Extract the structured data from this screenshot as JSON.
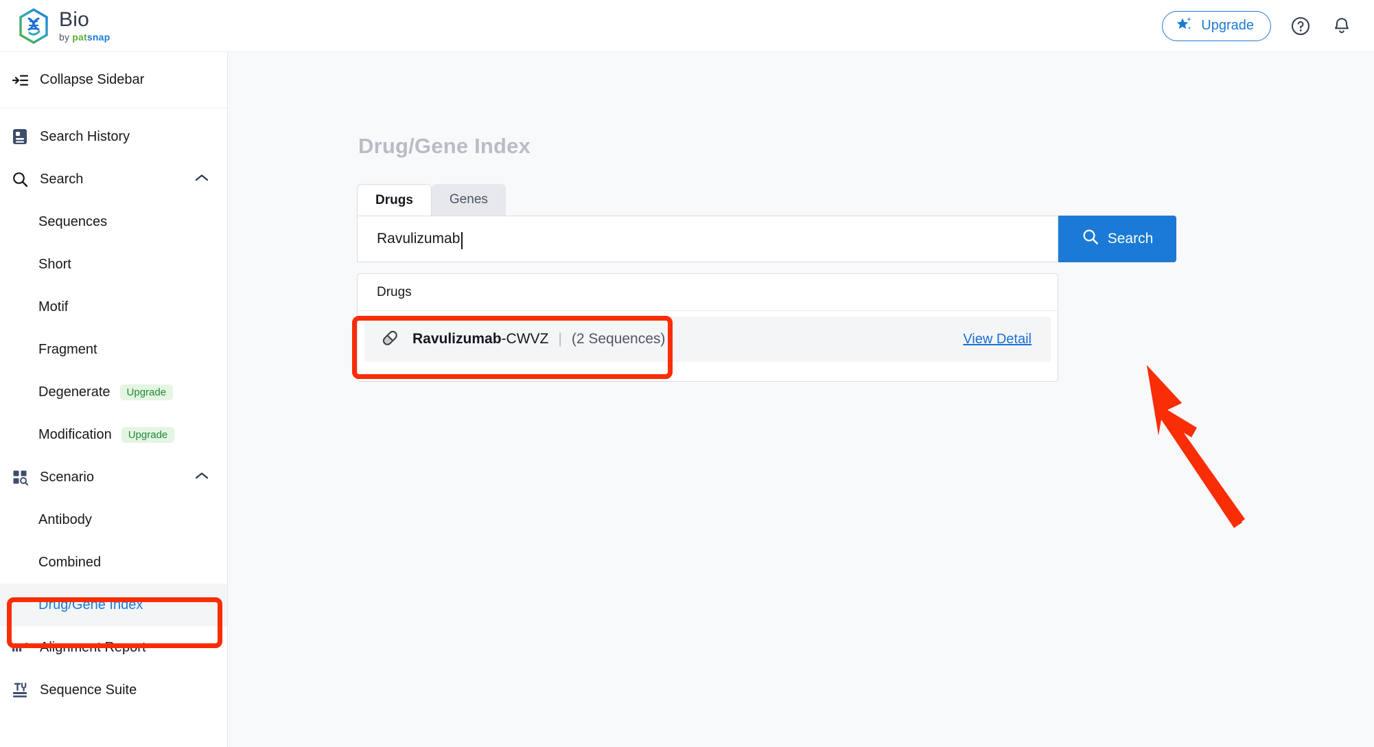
{
  "header": {
    "brand_title": "Bio",
    "brand_by": "by ",
    "brand_pat": "pat",
    "brand_snap": "snap",
    "upgrade_label": "Upgrade",
    "help_icon": "help-circle-icon",
    "bell_icon": "bell-icon",
    "star_icon": "star-sparkle-icon",
    "accent_blue": "#1b7ad6"
  },
  "sidebar": {
    "collapse_label": "Collapse Sidebar",
    "items": [
      {
        "label": "Search History",
        "icon": "history-document-icon",
        "type": "item"
      },
      {
        "label": "Search",
        "icon": "magnifier-icon",
        "type": "group",
        "chevron": "chevron-up-icon"
      },
      {
        "label": "Sequences",
        "type": "sub"
      },
      {
        "label": "Short",
        "type": "sub"
      },
      {
        "label": "Motif",
        "type": "sub"
      },
      {
        "label": "Fragment",
        "type": "sub"
      },
      {
        "label": "Degenerate",
        "type": "sub",
        "badge": "Upgrade"
      },
      {
        "label": "Modification",
        "type": "sub",
        "badge": "Upgrade"
      },
      {
        "label": "Scenario",
        "icon": "grid-search-icon",
        "type": "group",
        "chevron": "chevron-up-icon"
      },
      {
        "label": "Antibody",
        "type": "sub"
      },
      {
        "label": "Combined",
        "type": "sub"
      },
      {
        "label": "Drug/Gene Index",
        "type": "sub",
        "active": true
      },
      {
        "label": "Alignment Report",
        "icon": "alignment-bars-icon",
        "type": "item"
      },
      {
        "label": "Sequence Suite",
        "icon": "tools-icon",
        "type": "item"
      }
    ]
  },
  "main": {
    "page_title": "Drug/Gene Index",
    "tabs": [
      {
        "label": "Drugs",
        "active": true
      },
      {
        "label": "Genes",
        "active": false
      }
    ],
    "search": {
      "value": "Ravulizumab",
      "placeholder": "",
      "button_label": "Search",
      "button_icon": "search-icon"
    },
    "suggestions": {
      "group_label": "Drugs",
      "rows": [
        {
          "icon": "pill-capsule-icon",
          "name_bold": "Ravulizumab",
          "name_rest": "-CWVZ",
          "separator": "|",
          "count": "(2 Sequences)",
          "link": "View Detail"
        }
      ]
    }
  },
  "annotations": {
    "highlight_color": "#f92d06",
    "boxes": [
      {
        "name": "sidebar-drug-gene-index-highlight"
      },
      {
        "name": "suggestion-row-highlight"
      }
    ],
    "arrow": {
      "name": "pointer-arrow",
      "points_to": "View Detail"
    }
  }
}
